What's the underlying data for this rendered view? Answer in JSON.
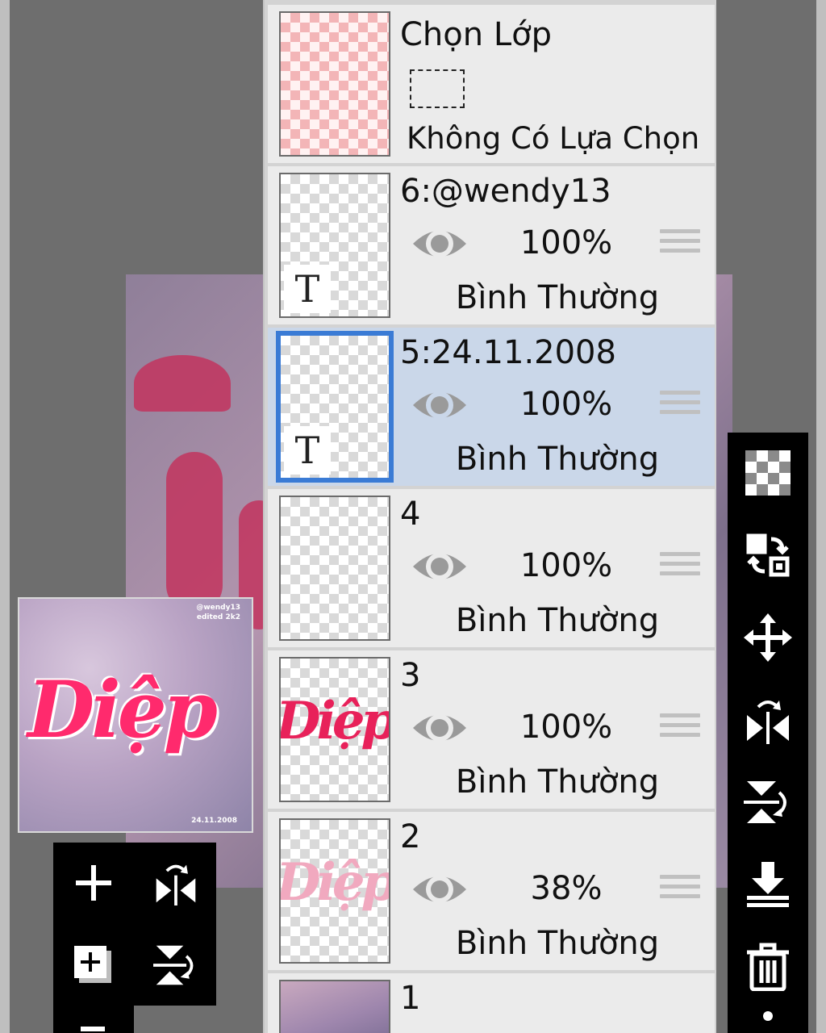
{
  "selection_row": {
    "title": "Chọn Lớp",
    "status": "Không Có Lựa Chọn"
  },
  "layers": [
    {
      "name": "6:@wendy13",
      "opacity": "100%",
      "blend": "Bình Thường",
      "type": "text"
    },
    {
      "name": "5:24.11.2008",
      "opacity": "100%",
      "blend": "Bình Thường",
      "type": "text",
      "selected": true
    },
    {
      "name": "4",
      "opacity": "100%",
      "blend": "Bình Thường",
      "type": "empty"
    },
    {
      "name": "3",
      "opacity": "100%",
      "blend": "Bình Thường",
      "type": "art"
    },
    {
      "name": "2",
      "opacity": "38%",
      "blend": "Bình Thường",
      "type": "art-faint"
    },
    {
      "name": "1",
      "type": "photo"
    }
  ],
  "text_layer_badge": "T",
  "preview": {
    "artwork_text": "Diệp",
    "tag_line_1": "@wendy13",
    "tag_line_2": "edited 2k2",
    "date": "24.11.2008"
  },
  "thumbnail_art_text": "Diệp",
  "right_toolbar": [
    "transparency-checker-icon",
    "copy-merge-icon",
    "move-icon",
    "flip-horizontal-icon",
    "flip-vertical-icon",
    "merge-down-icon",
    "delete-layer-icon",
    "more-icon"
  ],
  "left_toolbar": [
    "add-layer-icon",
    "flip-layer-horizontal-icon",
    "add-layer-copy-icon",
    "flip-layer-vertical-icon"
  ],
  "colors": {
    "selected_row": "#cad7e9",
    "selected_border": "#3a7bd5",
    "accent_pink": "#ff2a6d"
  }
}
